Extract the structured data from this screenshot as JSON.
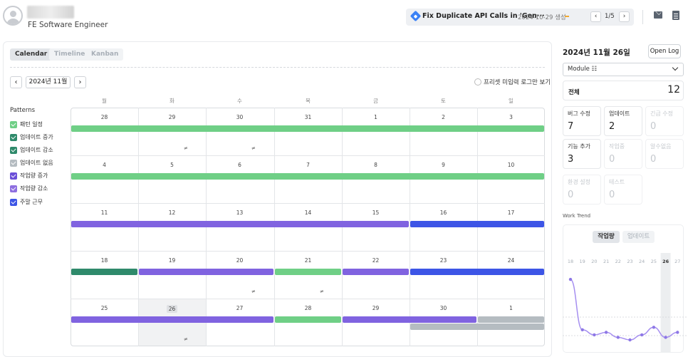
{
  "header": {
    "user_role": "FE Software Engineer",
    "task": {
      "title": "Fix Duplicate API Calls in 'Gen···",
      "date": "2024-10-29 생성",
      "page": "1/5",
      "prev_label": "‹",
      "next_label": "›"
    },
    "icons": [
      "mail-icon",
      "document-icon"
    ]
  },
  "tabs": [
    {
      "label": "Calendar",
      "active": true
    },
    {
      "label": "Timeline",
      "active": false
    },
    {
      "label": "Kanban",
      "active": false
    }
  ],
  "month_nav": {
    "prev": "‹",
    "label": "2024년 11월",
    "next": "›"
  },
  "preset_toggle_label": "프리셋 미입력 로그만 보기",
  "patterns": {
    "title": "Patterns",
    "items": [
      {
        "label": "패턴 일정",
        "color": "#6fcf86"
      },
      {
        "label": "업데이트 증가",
        "color": "#2f8a6b"
      },
      {
        "label": "업데이트 감소",
        "color": "#2f8a6b"
      },
      {
        "label": "업데이트 없음",
        "color": "#b5bcc1"
      },
      {
        "label": "작업량 증가",
        "color": "#6b4fd8"
      },
      {
        "label": "작업량 감소",
        "color": "#8e6fe0"
      },
      {
        "label": "주말 근무",
        "color": "#3d55e6"
      }
    ]
  },
  "calendar": {
    "weekdays": [
      "월",
      "화",
      "수",
      "목",
      "금",
      "토",
      "일"
    ],
    "weeks": [
      [
        "28",
        "29",
        "30",
        "31",
        "1",
        "2",
        "3"
      ],
      [
        "4",
        "5",
        "6",
        "7",
        "8",
        "9",
        "10"
      ],
      [
        "11",
        "12",
        "13",
        "14",
        "15",
        "16",
        "17"
      ],
      [
        "18",
        "19",
        "20",
        "21",
        "22",
        "23",
        "24"
      ],
      [
        "25",
        "26",
        "27",
        "28",
        "29",
        "30",
        "1"
      ]
    ],
    "note_symbol": "≠",
    "colors": {
      "green": "#6fcf86",
      "dark_green": "#2f8a6b",
      "purple": "#8063e0",
      "blue": "#3d55e6",
      "gray": "#b5bcc1"
    }
  },
  "side": {
    "date": "2024년 11월 26일",
    "open_log": "Open Log",
    "module_label": "Module ☷",
    "total_label": "전체",
    "total_value": "12",
    "stats": [
      {
        "label": "버그 수정",
        "value": "7"
      },
      {
        "label": "업데이트",
        "value": "2"
      },
      {
        "label": "긴급 수정",
        "value": "0"
      },
      {
        "label": "기능 추가",
        "value": "3"
      },
      {
        "label": "작업중",
        "value": "0"
      },
      {
        "label": "알수없음",
        "value": "0"
      },
      {
        "label": "환경 설정",
        "value": "0"
      },
      {
        "label": "테스트",
        "value": "0"
      }
    ],
    "trend_title": "Work Trend",
    "trend_tabs": [
      "작업량",
      "업데이트"
    ]
  },
  "chart_data": {
    "type": "line",
    "categories": [
      "18",
      "19",
      "20",
      "21",
      "22",
      "23",
      "24",
      "25",
      "26",
      "27"
    ],
    "values": [
      12,
      2,
      1,
      1.5,
      0.5,
      0,
      1,
      2.5,
      0.5,
      1.5
    ],
    "highlight_category": "26",
    "color": "#a58ef0"
  }
}
